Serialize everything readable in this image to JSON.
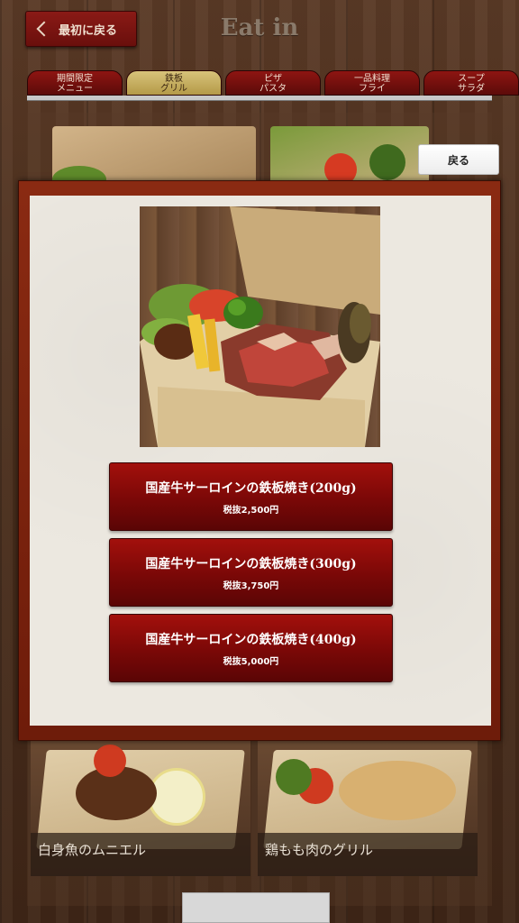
{
  "header": {
    "back_label": "最初に戻る",
    "title": "Eat in"
  },
  "tabs": [
    {
      "line1": "期間限定",
      "line2": "メニュー",
      "active": false
    },
    {
      "line1": "鉄板",
      "line2": "グリル",
      "active": true
    },
    {
      "line1": "ピザ",
      "line2": "パスタ",
      "active": false
    },
    {
      "line1": "一品料理",
      "line2": "フライ",
      "active": false
    },
    {
      "line1": "スープ",
      "line2": "サラダ",
      "active": false
    }
  ],
  "return_button": {
    "label": "戻る"
  },
  "modal": {
    "options": [
      {
        "name": "国産牛サーロインの鉄板焼き(200g)",
        "price": "税抜2,500円"
      },
      {
        "name": "国産牛サーロインの鉄板焼き(300g)",
        "price": "税抜3,750円"
      },
      {
        "name": "国産牛サーロインの鉄板焼き(400g)",
        "price": "税抜5,000円"
      }
    ]
  },
  "background_items": [
    {
      "name": "白身魚のムニエル"
    },
    {
      "name": "鶏もも肉のグリル"
    }
  ],
  "colors": {
    "accent_red": "#7a0807",
    "active_tab": "#d8c37a",
    "modal_frame": "#7e220e"
  }
}
